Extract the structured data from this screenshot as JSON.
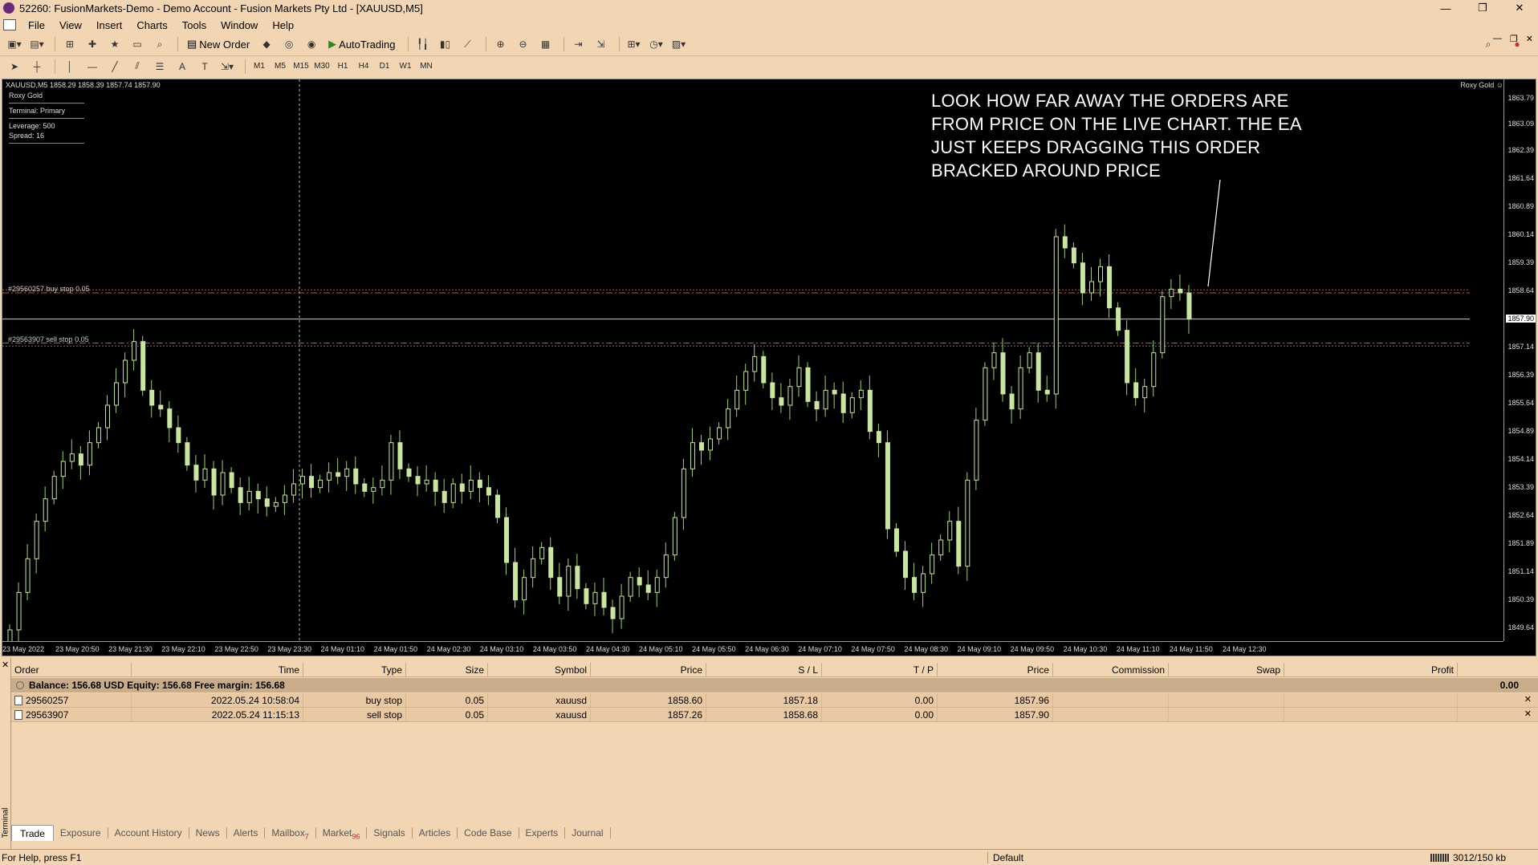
{
  "window": {
    "title": "52260: FusionMarkets-Demo - Demo Account - Fusion Markets Pty Ltd - [XAUUSD,M5]"
  },
  "menu": [
    "File",
    "View",
    "Insert",
    "Charts",
    "Tools",
    "Window",
    "Help"
  ],
  "toolbar": {
    "new_order": "New Order",
    "autotrading": "AutoTrading"
  },
  "timeframes": [
    "M1",
    "M5",
    "M15",
    "M30",
    "H1",
    "H4",
    "D1",
    "W1",
    "MN"
  ],
  "chart": {
    "symbol_line": "XAUUSD,M5  1858.29 1858.39 1857.74 1857.90",
    "ea_name": "Roxy Gold",
    "ea_terminal": "Terminal: Primary",
    "leverage": "Leverage: 500",
    "spread": "Spread: 16",
    "ea_name_right": "Roxy Gold ☺",
    "annotation": [
      "LOOK HOW FAR AWAY THE ORDERS ARE",
      "FROM PRICE ON THE LIVE CHART. THE EA",
      "JUST KEEPS DRAGGING THIS ORDER",
      "BRACKED AROUND PRICE"
    ],
    "buy_stop_tag": "#29560257 buy stop 0.05",
    "sell_stop_tag": "#29563907 sell stop 0.05",
    "buy_stop_price": 1858.6,
    "sell_stop_price": 1857.26,
    "buy_sl": 1857.18,
    "sell_sl": 1858.68,
    "current_price": 1857.9,
    "current_price_label": "1857.90",
    "y_ticks": [
      "1863.79",
      "1863.09",
      "1862.39",
      "1861.64",
      "1860.89",
      "1860.14",
      "1859.39",
      "1858.64",
      "1857.14",
      "1856.39",
      "1855.64",
      "1854.89",
      "1854.14",
      "1853.39",
      "1852.64",
      "1851.89",
      "1851.14",
      "1850.39",
      "1849.64"
    ],
    "x_ticks": [
      "23 May 2022",
      "23 May 20:50",
      "23 May 21:30",
      "23 May 22:10",
      "23 May 22:50",
      "23 May 23:30",
      "24 May 01:10",
      "24 May 01:50",
      "24 May 02:30",
      "24 May 03:10",
      "24 May 03:50",
      "24 May 04:30",
      "24 May 05:10",
      "24 May 05:50",
      "24 May 06:30",
      "24 May 07:10",
      "24 May 07:50",
      "24 May 08:30",
      "24 May 09:10",
      "24 May 09:50",
      "24 May 10:30",
      "24 May 11:10",
      "24 May 11:50",
      "24 May 12:30"
    ]
  },
  "chart_data": {
    "type": "candlestick",
    "title": "XAUUSD,M5",
    "ylim": [
      1849.3,
      1864.3
    ],
    "close_series": [
      1849.6,
      1850.6,
      1851.5,
      1852.5,
      1853.1,
      1853.7,
      1854.1,
      1854.3,
      1854.0,
      1854.6,
      1855.0,
      1855.6,
      1856.2,
      1856.8,
      1857.3,
      1856.0,
      1855.6,
      1855.5,
      1855.0,
      1854.6,
      1854.0,
      1853.6,
      1853.9,
      1853.2,
      1853.8,
      1853.4,
      1853.0,
      1853.3,
      1853.1,
      1852.9,
      1853.0,
      1853.2,
      1853.5,
      1853.7,
      1853.4,
      1853.6,
      1853.8,
      1853.7,
      1853.9,
      1853.5,
      1853.3,
      1853.4,
      1853.6,
      1854.6,
      1853.9,
      1853.7,
      1853.5,
      1853.6,
      1853.3,
      1853.0,
      1853.5,
      1853.3,
      1853.6,
      1853.4,
      1853.2,
      1852.6,
      1851.4,
      1850.4,
      1851.0,
      1851.5,
      1851.8,
      1851.0,
      1850.5,
      1851.3,
      1850.7,
      1850.3,
      1850.6,
      1850.2,
      1849.9,
      1850.5,
      1851.0,
      1850.8,
      1850.6,
      1851.0,
      1851.6,
      1852.6,
      1853.9,
      1854.6,
      1854.4,
      1854.7,
      1855.0,
      1855.5,
      1856.0,
      1856.5,
      1856.9,
      1856.2,
      1855.8,
      1855.6,
      1856.1,
      1856.6,
      1855.7,
      1855.5,
      1856.0,
      1855.9,
      1855.4,
      1855.8,
      1856.0,
      1854.9,
      1854.6,
      1852.3,
      1851.7,
      1851.0,
      1850.6,
      1851.1,
      1851.6,
      1852.0,
      1852.5,
      1851.3,
      1853.6,
      1855.2,
      1856.6,
      1857.0,
      1855.9,
      1855.5,
      1856.6,
      1857.0,
      1856.0,
      1855.9,
      1860.1,
      1859.8,
      1859.4,
      1858.6,
      1858.9,
      1859.3,
      1858.2,
      1857.6,
      1856.2,
      1855.8,
      1856.1,
      1857.0,
      1858.5,
      1858.7,
      1858.6,
      1857.9
    ],
    "buy_stop_price": 1858.6,
    "sell_stop_price": 1857.26,
    "current_price": 1857.9
  },
  "terminal": {
    "columns": [
      {
        "label": "Order",
        "w": 150,
        "align": "l"
      },
      {
        "label": "Time",
        "w": 214,
        "align": "r"
      },
      {
        "label": "Type",
        "w": 128,
        "align": "r"
      },
      {
        "label": "Size",
        "w": 102,
        "align": "r"
      },
      {
        "label": "Symbol",
        "w": 128,
        "align": "r"
      },
      {
        "label": "Price",
        "w": 144,
        "align": "r"
      },
      {
        "label": "S / L",
        "w": 144,
        "align": "r"
      },
      {
        "label": "T / P",
        "w": 144,
        "align": "r"
      },
      {
        "label": "Price",
        "w": 144,
        "align": "r"
      },
      {
        "label": "Commission",
        "w": 144,
        "align": "r"
      },
      {
        "label": "Swap",
        "w": 144,
        "align": "r"
      },
      {
        "label": "Profit",
        "w": 216,
        "align": "r"
      }
    ],
    "balance_line": "Balance: 156.68 USD  Equity: 156.68  Free margin: 156.68",
    "total_profit": "0.00",
    "orders": [
      {
        "order": "29560257",
        "time": "2022.05.24 10:58:04",
        "type": "buy stop",
        "size": "0.05",
        "symbol": "xauusd",
        "price": "1858.60",
        "sl": "1857.18",
        "tp": "0.00",
        "cur": "1857.96",
        "commission": "",
        "swap": "",
        "profit": ""
      },
      {
        "order": "29563907",
        "time": "2022.05.24 11:15:13",
        "type": "sell stop",
        "size": "0.05",
        "symbol": "xauusd",
        "price": "1857.26",
        "sl": "1858.68",
        "tp": "0.00",
        "cur": "1857.90",
        "commission": "",
        "swap": "",
        "profit": ""
      }
    ],
    "tabs": [
      {
        "label": "Trade",
        "badge": ""
      },
      {
        "label": "Exposure",
        "badge": ""
      },
      {
        "label": "Account History",
        "badge": ""
      },
      {
        "label": "News",
        "badge": ""
      },
      {
        "label": "Alerts",
        "badge": ""
      },
      {
        "label": "Mailbox",
        "badge": "7"
      },
      {
        "label": "Market",
        "badge": "96"
      },
      {
        "label": "Signals",
        "badge": ""
      },
      {
        "label": "Articles",
        "badge": ""
      },
      {
        "label": "Code Base",
        "badge": ""
      },
      {
        "label": "Experts",
        "badge": ""
      },
      {
        "label": "Journal",
        "badge": ""
      }
    ],
    "side_label": "Terminal"
  },
  "status": {
    "help": "For Help, press F1",
    "profile": "Default",
    "traffic": "3012/150 kb"
  },
  "colors": {
    "candle": "#c8e6a0",
    "wick": "#9fcf6e",
    "order_line": "#c8502a",
    "price_line": "#ccc"
  }
}
